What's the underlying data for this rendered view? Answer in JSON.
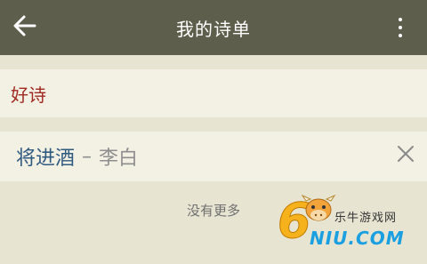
{
  "header": {
    "back_icon": "arrow-left-icon",
    "title": "我的诗单",
    "more_icon": "more-vertical-icon"
  },
  "list": {
    "section_title": "好诗",
    "items": [
      {
        "title": "将进酒",
        "separator": "–",
        "author": "李白",
        "remove_icon": "close-icon"
      }
    ],
    "footer_text": "没有更多"
  },
  "watermark": {
    "digit": "6",
    "name_cn": "乐牛游戏网",
    "domain": "NIU.COM"
  },
  "colors": {
    "topbar": "#5e5e4c",
    "background": "#e8e4d2",
    "row_background": "#f3f0e4",
    "section_title": "#a02a22",
    "poem_title": "#2f5a80",
    "muted_text": "#8e8e8e"
  }
}
